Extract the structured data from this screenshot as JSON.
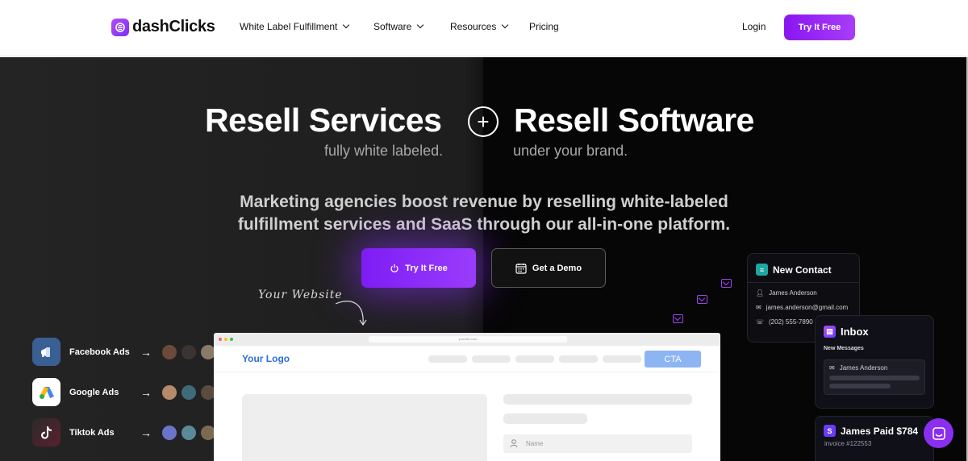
{
  "brand": {
    "name": "dashClicks",
    "accent": "#8a16f0"
  },
  "nav": {
    "items": [
      {
        "label": "White Label Fulfillment",
        "has_dropdown": true
      },
      {
        "label": "Software",
        "has_dropdown": true
      },
      {
        "label": "Resources",
        "has_dropdown": true
      },
      {
        "label": "Pricing",
        "has_dropdown": false
      }
    ],
    "login": "Login",
    "cta": "Try It Free"
  },
  "hero": {
    "headline_left": "Resell Services",
    "headline_right": "Resell Software",
    "plus_symbol": "+",
    "sub_left": "fully white labeled.",
    "sub_right": "under your brand.",
    "tagline_line1": "Marketing agencies boost revenue by reselling white-labeled",
    "tagline_line2": "fulfillment services and SaaS through our all-in-one platform.",
    "primary_button": "Try It Free",
    "secondary_button": "Get a Demo",
    "handwritten_note": "Your Website"
  },
  "services": [
    {
      "label": "Facebook Ads",
      "icon": "megaphone-icon"
    },
    {
      "label": "Google Ads",
      "icon": "google-ads-icon"
    },
    {
      "label": "Tiktok Ads",
      "icon": "tiktok-icon"
    }
  ],
  "browser_mock": {
    "url": "yoursite.com",
    "logo": "Your Logo",
    "cta": "CTA",
    "name_placeholder": "Name"
  },
  "cards": {
    "new_contact": {
      "title": "New Contact",
      "name": "James Anderson",
      "email": "james.anderson@gmail.com",
      "phone": "(202) 555-7890"
    },
    "inbox": {
      "title": "Inbox",
      "subtitle": "New Messages",
      "message_from": "James Anderson"
    },
    "payment": {
      "title": "James Paid $784",
      "invoice": "invoice #122553"
    }
  }
}
